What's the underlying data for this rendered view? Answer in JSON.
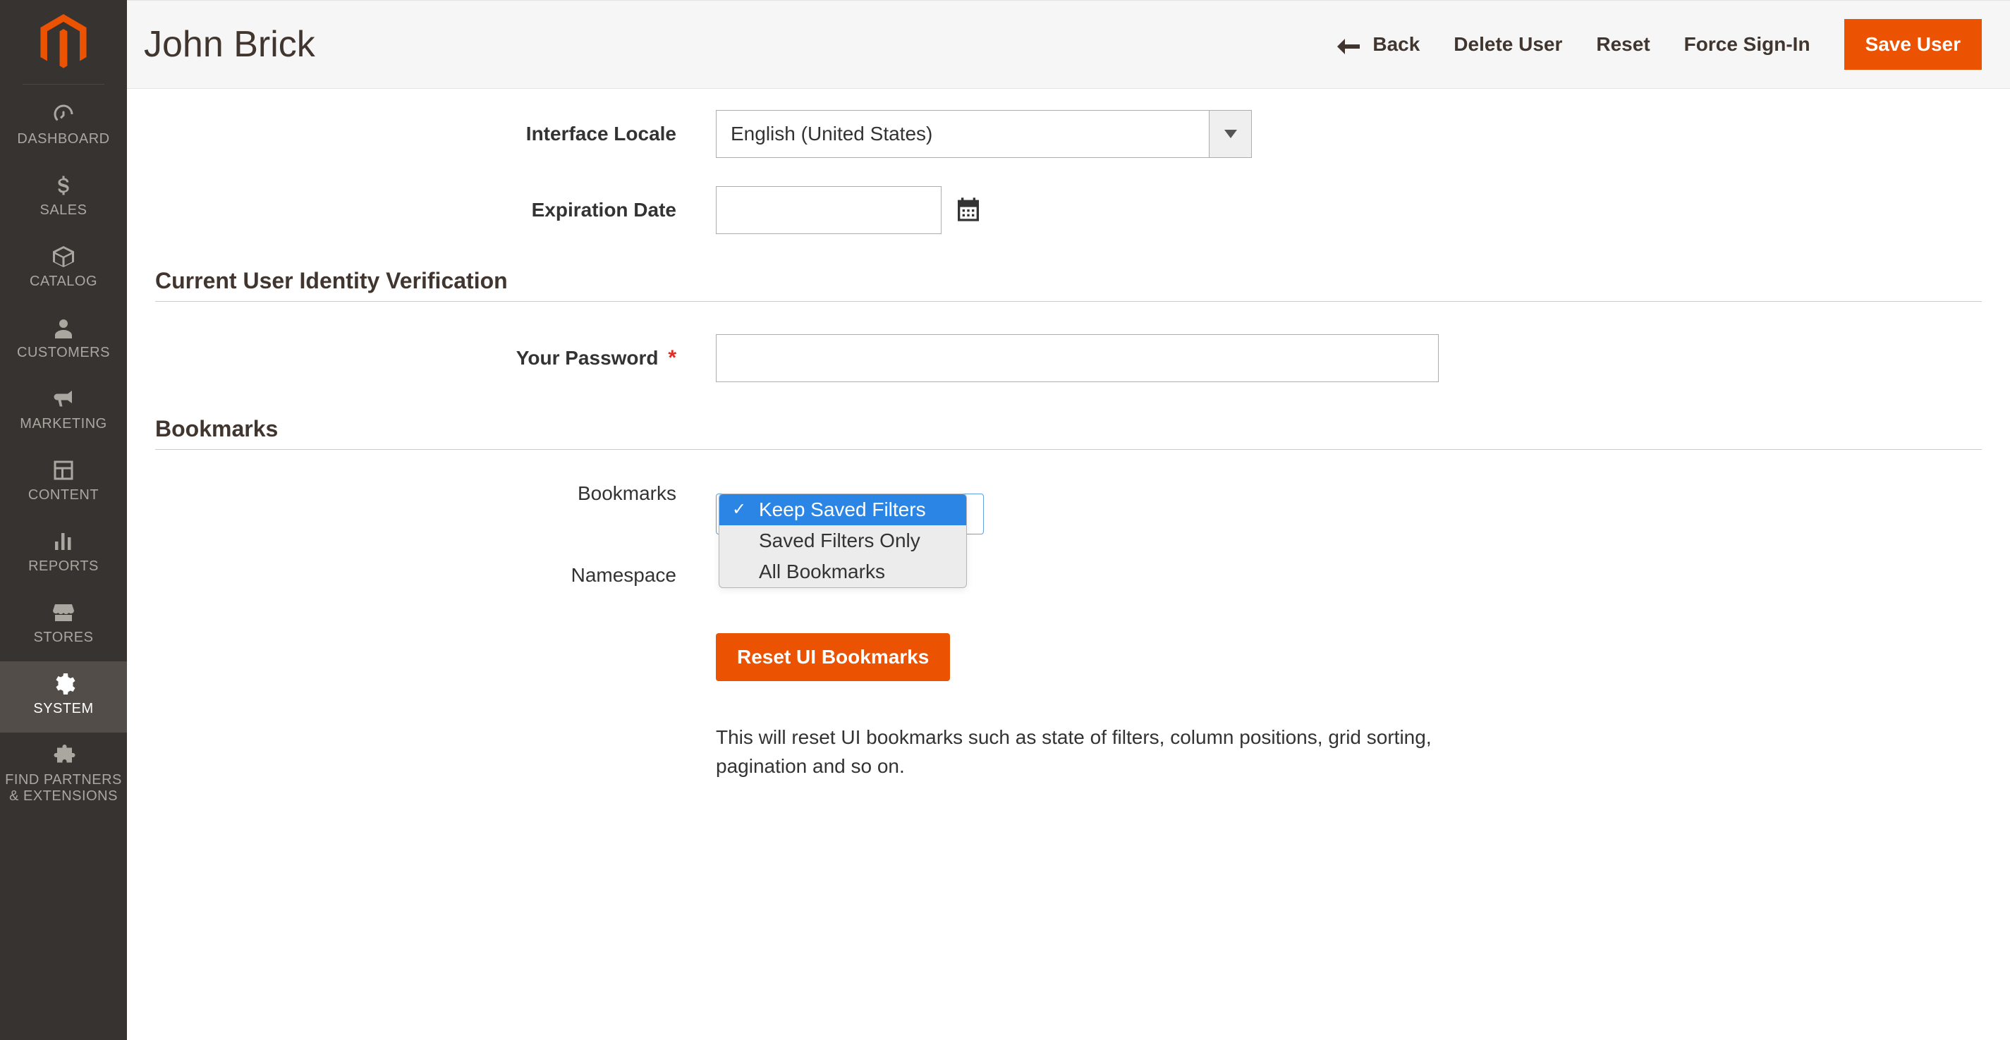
{
  "sidebar": {
    "items": [
      {
        "label": "DASHBOARD"
      },
      {
        "label": "SALES"
      },
      {
        "label": "CATALOG"
      },
      {
        "label": "CUSTOMERS"
      },
      {
        "label": "MARKETING"
      },
      {
        "label": "CONTENT"
      },
      {
        "label": "REPORTS"
      },
      {
        "label": "STORES"
      },
      {
        "label": "SYSTEM"
      },
      {
        "label": "FIND PARTNERS & EXTENSIONS"
      }
    ]
  },
  "header": {
    "title": "John Brick",
    "back_label": "Back",
    "delete_label": "Delete User",
    "reset_label": "Reset",
    "force_signin_label": "Force Sign-In",
    "save_label": "Save User"
  },
  "form": {
    "locale_label": "Interface Locale",
    "locale_value": "English (United States)",
    "expiration_label": "Expiration Date",
    "expiration_value": ""
  },
  "identity": {
    "section_title": "Current User Identity Verification",
    "password_label": "Your Password",
    "password_value": ""
  },
  "bookmarks": {
    "section_title": "Bookmarks",
    "bookmarks_label": "Bookmarks",
    "namespace_label": "Namespace",
    "options": [
      "Keep Saved Filters",
      "Saved Filters Only",
      "All Bookmarks"
    ],
    "reset_button": "Reset UI Bookmarks",
    "help_text": "This will reset UI bookmarks such as state of filters, column positions, grid sorting, pagination and so on."
  }
}
